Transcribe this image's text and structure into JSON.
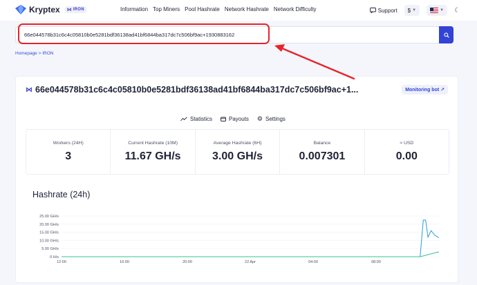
{
  "header": {
    "brand": "Kryptex",
    "coin_badge": "IRON",
    "nav": [
      "Information",
      "Top Miners",
      "Pool Hashrate",
      "Network Hashrate",
      "Network Difficulty"
    ],
    "support": "Support",
    "currency": "$",
    "icons": [
      "kryptex-logo-icon",
      "support-chat-icon",
      "us-flag-icon",
      "moon-icon",
      "search-icon"
    ]
  },
  "search": {
    "value": "66e044578b31c6c4c05810b0e5281bdf36138ad41bf6844ba317dc7c506bf9ac+1930883162"
  },
  "breadcrumb": "Homepage > IRON",
  "wallet": {
    "address": "66e044578b31c6c4c05810b0e5281bdf36138ad41bf6844ba317dc7c506bf9ac+1...",
    "monitoring_label": "Monitoring bot ↗"
  },
  "tabs": [
    "Statistics",
    "Payouts",
    "Settings"
  ],
  "stats": [
    {
      "label": "Workers (24H)",
      "value": "3"
    },
    {
      "label": "Current Hashrate (10M)",
      "value": "11.67 GH/s"
    },
    {
      "label": "Average Hashrate (6H)",
      "value": "3.00 GH/s"
    },
    {
      "label": "Balance",
      "value": "0.007301"
    },
    {
      "label": "≈ USD",
      "value": "0.00"
    }
  ],
  "colors": {
    "accent": "#3243d6",
    "highlight": "#e8232a",
    "series_hashrate": "#2b9bd8",
    "series_average": "#33c48a"
  },
  "chart_data": {
    "type": "line",
    "title": "Hashrate (24h)",
    "x_ticks": [
      "12:00",
      "16:00",
      "20:00",
      "22 Apr",
      "04:00",
      "08:00"
    ],
    "y_ticks": [
      "0 H/s",
      "5.00 GH/s",
      "10.00 GH/s",
      "15.00 GH/s",
      "20.00 GH/s",
      "25.00 GH/s"
    ],
    "ylim": [
      0,
      25
    ],
    "xlim": [
      0,
      24
    ],
    "series": [
      {
        "x": [
          0,
          22.8,
          23.0,
          23.15,
          23.3,
          23.5,
          23.75,
          24.0
        ],
        "values": [
          0,
          0,
          22.5,
          22.5,
          12,
          16,
          13,
          11.6
        ]
      },
      {
        "x": [
          0,
          22.8,
          23.2,
          24.0
        ],
        "values": [
          0,
          0,
          1.0,
          3.0
        ]
      }
    ]
  }
}
